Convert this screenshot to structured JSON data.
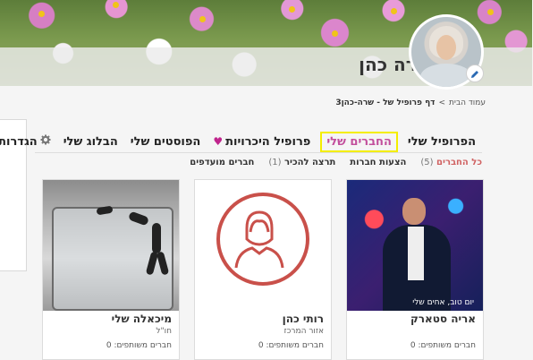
{
  "profile": {
    "name": "שרה כהן"
  },
  "breadcrumb": {
    "home": "עמוד הבית",
    "sep": ">",
    "current": "דף פרופיל של - שרה-כהן3"
  },
  "tabs": [
    {
      "label": "הפרופיל שלי"
    },
    {
      "label": "החברים שלי",
      "active": true
    },
    {
      "label": "פרופיל היכרויות"
    },
    {
      "label": "הפוסטים שלי"
    },
    {
      "label": "הבלוג שלי"
    },
    {
      "label": "הגדרות"
    }
  ],
  "subtabs": {
    "all": "כל החברים",
    "all_count": "(5)",
    "suggestions": "הצעות חברות",
    "requests": "תרצה להכיר",
    "requests_count": "(1)",
    "favorites": "חברים מועדפים"
  },
  "friends": [
    {
      "name": "אריה סטארק",
      "sub": "",
      "mutual": "חברים משותפים: 0",
      "caption": "יום טוב, אחים שלי"
    },
    {
      "name": "רותי כהן",
      "sub": "אזור המרכז",
      "mutual": "חברים משותפים: 0"
    },
    {
      "name": "מיכאלה שלי",
      "sub": "חו\"ל",
      "mutual": "חברים משותפים: 0"
    }
  ],
  "colors": {
    "accent": "#c24e9c",
    "highlight": "#f4ee00",
    "placeholder": "#c9504a"
  }
}
